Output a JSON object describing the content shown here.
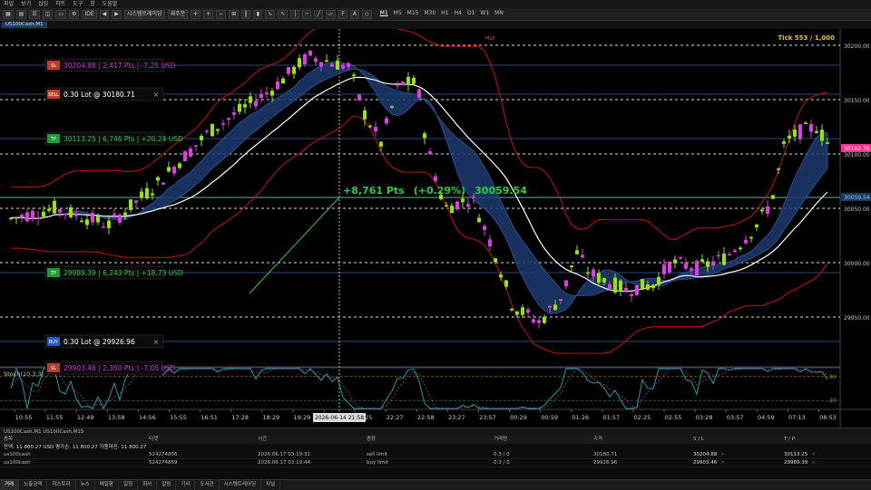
{
  "menu": [
    "파일",
    "보기",
    "삽입",
    "차트",
    "도구",
    "창",
    "도움말"
  ],
  "toolbar": {
    "algo_label": "시스템트레이딩",
    "new_order_label": "새주문",
    "timeframes": [
      "M1",
      "M5",
      "M15",
      "M30",
      "H1",
      "H4",
      "D1",
      "W1",
      "MN"
    ],
    "active_timeframe": "M1"
  },
  "chart_tab": "US100Cash,M1",
  "chart": {
    "symbol_label": "US100Cash,M1",
    "tick_info": "Tick 553 / 1,000",
    "mid_marker": "M15",
    "price_ticks": [
      "30200.00",
      "30150.00",
      "30100.00",
      "30050.00",
      "30000.00",
      "29950.00"
    ],
    "current_price": "30102.76",
    "ref_price": "30059.54",
    "time_ticks": [
      "10:55",
      "11:55",
      "12:49",
      "13:58",
      "14:56",
      "15:55",
      "16:51",
      "17:28",
      "18:29",
      "19:29",
      "20:27",
      "21:25",
      "22:27",
      "22:58",
      "23:27",
      "23:57",
      "00:29",
      "00:59",
      "01:26",
      "01:57",
      "02:25",
      "02:55",
      "03:28",
      "03:57",
      "04:59",
      "07:13",
      "08:53"
    ],
    "cursor_time": "2026-06-14 21:58",
    "measure": {
      "pts": "+8,761 Pts",
      "pct": "(+0.29%)",
      "price": "30059.54"
    },
    "orders": [
      {
        "tag": "SL",
        "text": "30204.88 | 2,417 Pts | -7.25 USD",
        "color": "#c42fd8",
        "tag_color": "#c0392b"
      },
      {
        "tag": "SELL",
        "text": "0.30 Lot @ 30180.71",
        "color": "#ffffff",
        "tag_color": "#c0392b"
      },
      {
        "tag": "TP",
        "text": "30113.25 | 6,746 Pts | +20.24 USD",
        "color": "#2ecc40",
        "tag_color": "#1e9e3a"
      },
      {
        "tag": "TP",
        "text": "29989.39 | 6,243 Pts | +18.73 USD",
        "color": "#2ecc40",
        "tag_color": "#1e9e3a"
      },
      {
        "tag": "BUY",
        "text": "0.30 Lot @ 29926.96",
        "color": "#ffffff",
        "tag_color": "#1f5fbf"
      },
      {
        "tag": "SL",
        "text": "29903.46 | 2,350 Pts | -7.05 USD",
        "color": "#c42fd8",
        "tag_color": "#c0392b"
      }
    ],
    "stoch_label": "Stoch(10,3,3)",
    "stoch_levels": [
      "80",
      "20"
    ]
  },
  "status": "US100Cash,M1  US100Cash,M15",
  "trade_table": {
    "headers": [
      "종목",
      "티켓",
      "시간",
      "종류",
      "거래량",
      "가격",
      "S / L",
      "T / P"
    ],
    "account_line": "잔액: 11 800.27 USD  평가손: 11 800.27  가용마진: 11 800.27",
    "rows": [
      [
        "us100cash",
        "524274856",
        "2026.06.17 03:19:32",
        "sell limit",
        "0.3 / 0",
        "30180.71",
        "30204.88",
        "30113.25"
      ],
      [
        "us100cash",
        "524274859",
        "2026.06.17 03:19:44",
        "buy limit",
        "0.3 / 0",
        "29926.96",
        "29903.46",
        "29989.39"
      ]
    ]
  },
  "bottom_tabs": [
    "거래",
    "노출금액",
    "히스토리",
    "뉴스",
    "메일함",
    "일정",
    "회사",
    "알림",
    "기사",
    "도서관",
    "시스템트레이딩",
    "저널"
  ],
  "active_bottom_tab": "거래",
  "colors": {
    "bull": "#9be300",
    "bear": "#e03ce0",
    "band": "#cc1111",
    "ma": "#ffffff",
    "cloud": "#1c3a6e",
    "accent": "#ff2f8a"
  }
}
